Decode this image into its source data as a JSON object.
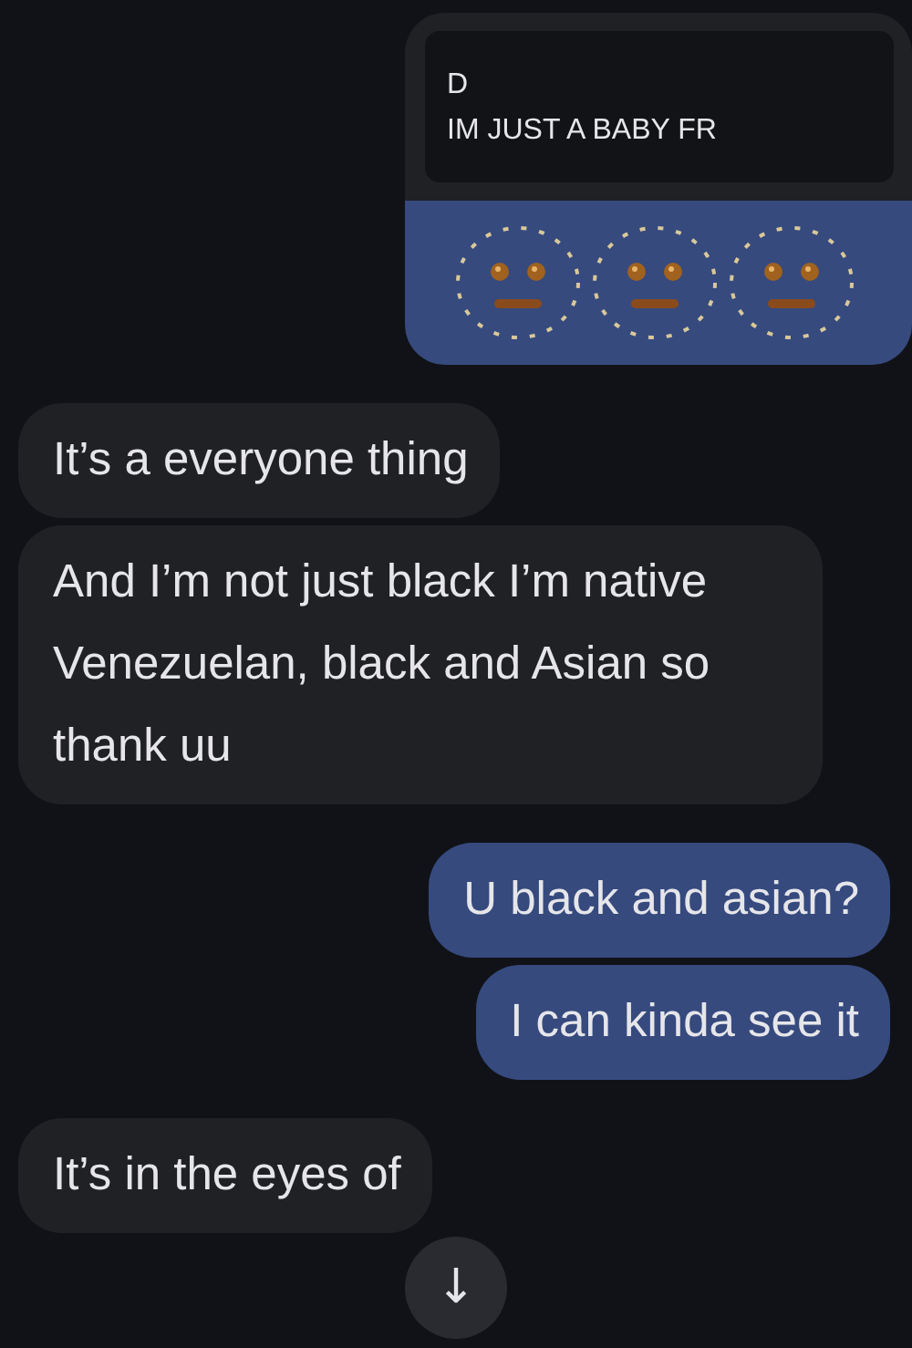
{
  "messages": [
    {
      "kind": "reply",
      "quote_author": "D",
      "quote_text": "IM JUST A BABY FR"
    },
    {
      "kind": "incoming",
      "text": "It’s a everyone thing"
    },
    {
      "kind": "incoming",
      "text": "And I’m not just black I’m native Venezuelan, black and Asian so thank uu"
    },
    {
      "kind": "outgoing",
      "text": "U black and asian?"
    },
    {
      "kind": "outgoing",
      "text": "I can kinda see it"
    },
    {
      "kind": "incoming",
      "text": "It’s in the eyes of"
    }
  ],
  "scroll_button": {
    "icon": "↓"
  }
}
